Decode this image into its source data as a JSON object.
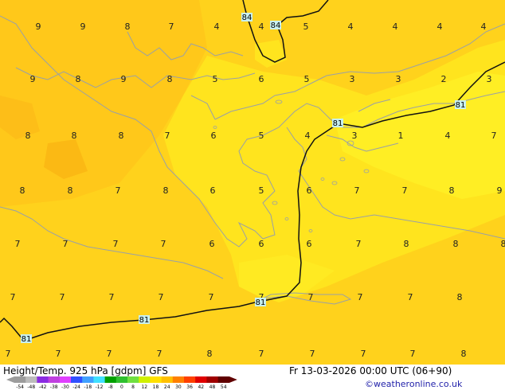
{
  "map": {
    "colors": {
      "base": "#ffd21c",
      "orange": "#ffc81a",
      "yellow_bright": "#ffee24",
      "yellow": "#ffe41e",
      "coast": "#9aa0a6",
      "contour": "#111111"
    },
    "grid_values": [
      {
        "t": "9"
      },
      {
        "t": "9"
      },
      {
        "t": "8"
      },
      {
        "t": "7"
      },
      {
        "t": "4"
      },
      {
        "t": "4"
      },
      {
        "t": "5"
      },
      {
        "t": "4"
      },
      {
        "t": "4"
      },
      {
        "t": "4"
      },
      {
        "t": "4"
      },
      {
        "t": "9"
      },
      {
        "t": "8"
      },
      {
        "t": "9"
      },
      {
        "t": "8"
      },
      {
        "t": "5"
      },
      {
        "t": "6"
      },
      {
        "t": "5"
      },
      {
        "t": "3"
      },
      {
        "t": "3"
      },
      {
        "t": "2"
      },
      {
        "t": "3"
      },
      {
        "t": "8"
      },
      {
        "t": "8"
      },
      {
        "t": "8"
      },
      {
        "t": "7"
      },
      {
        "t": "6"
      },
      {
        "t": "5"
      },
      {
        "t": "4"
      },
      {
        "t": "3"
      },
      {
        "t": "1"
      },
      {
        "t": "4"
      },
      {
        "t": "7"
      },
      {
        "t": "8"
      },
      {
        "t": "8"
      },
      {
        "t": "7"
      },
      {
        "t": "8"
      },
      {
        "t": "6"
      },
      {
        "t": "5"
      },
      {
        "t": "6"
      },
      {
        "t": "7"
      },
      {
        "t": "7"
      },
      {
        "t": "8"
      },
      {
        "t": "9"
      },
      {
        "t": "7"
      },
      {
        "t": "7"
      },
      {
        "t": "7"
      },
      {
        "t": "7"
      },
      {
        "t": "6"
      },
      {
        "t": "6"
      },
      {
        "t": "6"
      },
      {
        "t": "7"
      },
      {
        "t": "8"
      },
      {
        "t": "8"
      },
      {
        "t": "8"
      },
      {
        "t": "7"
      },
      {
        "t": "7"
      },
      {
        "t": "7"
      },
      {
        "t": "7"
      },
      {
        "t": "7"
      },
      {
        "t": "7"
      },
      {
        "t": "7"
      },
      {
        "t": "7"
      },
      {
        "t": "7"
      },
      {
        "t": "8"
      },
      {
        "t": "7"
      },
      {
        "t": "7"
      },
      {
        "t": "7"
      },
      {
        "t": "7"
      },
      {
        "t": "8"
      },
      {
        "t": "7"
      },
      {
        "t": "7"
      },
      {
        "t": "7"
      },
      {
        "t": "7"
      },
      {
        "t": "8"
      }
    ],
    "contour_labels": [
      {
        "t": "84"
      },
      {
        "t": "84"
      },
      {
        "t": "81"
      },
      {
        "t": "81"
      },
      {
        "t": "81"
      },
      {
        "t": "81"
      },
      {
        "t": "81"
      }
    ]
  },
  "footer": {
    "title": "Height/Temp. 925 hPa [gdpm] GFS",
    "datetime": "Fr 13-03-2026 00:00 UTC (06+90)",
    "credit": "©weatheronline.co.uk",
    "scale_ticks": [
      "-54",
      "-48",
      "-42",
      "-38",
      "-30",
      "-24",
      "-18",
      "-12",
      "-8",
      "0",
      "8",
      "12",
      "18",
      "24",
      "30",
      "36",
      "42",
      "48",
      "54"
    ],
    "scale_colors": [
      "#9c9c9c",
      "#bcbcbc",
      "#8a2be2",
      "#c040e0",
      "#e040ff",
      "#3050ff",
      "#40a0ff",
      "#40e0ff",
      "#00a000",
      "#30c030",
      "#70e040",
      "#d0f000",
      "#ffe000",
      "#ffc000",
      "#ff8000",
      "#ff4000",
      "#e00000",
      "#a00000",
      "#600000"
    ]
  }
}
